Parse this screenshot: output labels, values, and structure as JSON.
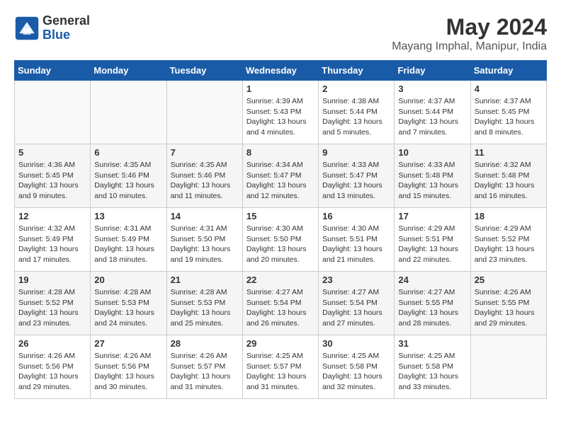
{
  "logo": {
    "general": "General",
    "blue": "Blue"
  },
  "title": "May 2024",
  "subtitle": "Mayang Imphal, Manipur, India",
  "weekdays": [
    "Sunday",
    "Monday",
    "Tuesday",
    "Wednesday",
    "Thursday",
    "Friday",
    "Saturday"
  ],
  "weeks": [
    [
      {
        "day": "",
        "info": ""
      },
      {
        "day": "",
        "info": ""
      },
      {
        "day": "",
        "info": ""
      },
      {
        "day": "1",
        "info": "Sunrise: 4:39 AM\nSunset: 5:43 PM\nDaylight: 13 hours\nand 4 minutes."
      },
      {
        "day": "2",
        "info": "Sunrise: 4:38 AM\nSunset: 5:44 PM\nDaylight: 13 hours\nand 5 minutes."
      },
      {
        "day": "3",
        "info": "Sunrise: 4:37 AM\nSunset: 5:44 PM\nDaylight: 13 hours\nand 7 minutes."
      },
      {
        "day": "4",
        "info": "Sunrise: 4:37 AM\nSunset: 5:45 PM\nDaylight: 13 hours\nand 8 minutes."
      }
    ],
    [
      {
        "day": "5",
        "info": "Sunrise: 4:36 AM\nSunset: 5:45 PM\nDaylight: 13 hours\nand 9 minutes."
      },
      {
        "day": "6",
        "info": "Sunrise: 4:35 AM\nSunset: 5:46 PM\nDaylight: 13 hours\nand 10 minutes."
      },
      {
        "day": "7",
        "info": "Sunrise: 4:35 AM\nSunset: 5:46 PM\nDaylight: 13 hours\nand 11 minutes."
      },
      {
        "day": "8",
        "info": "Sunrise: 4:34 AM\nSunset: 5:47 PM\nDaylight: 13 hours\nand 12 minutes."
      },
      {
        "day": "9",
        "info": "Sunrise: 4:33 AM\nSunset: 5:47 PM\nDaylight: 13 hours\nand 13 minutes."
      },
      {
        "day": "10",
        "info": "Sunrise: 4:33 AM\nSunset: 5:48 PM\nDaylight: 13 hours\nand 15 minutes."
      },
      {
        "day": "11",
        "info": "Sunrise: 4:32 AM\nSunset: 5:48 PM\nDaylight: 13 hours\nand 16 minutes."
      }
    ],
    [
      {
        "day": "12",
        "info": "Sunrise: 4:32 AM\nSunset: 5:49 PM\nDaylight: 13 hours\nand 17 minutes."
      },
      {
        "day": "13",
        "info": "Sunrise: 4:31 AM\nSunset: 5:49 PM\nDaylight: 13 hours\nand 18 minutes."
      },
      {
        "day": "14",
        "info": "Sunrise: 4:31 AM\nSunset: 5:50 PM\nDaylight: 13 hours\nand 19 minutes."
      },
      {
        "day": "15",
        "info": "Sunrise: 4:30 AM\nSunset: 5:50 PM\nDaylight: 13 hours\nand 20 minutes."
      },
      {
        "day": "16",
        "info": "Sunrise: 4:30 AM\nSunset: 5:51 PM\nDaylight: 13 hours\nand 21 minutes."
      },
      {
        "day": "17",
        "info": "Sunrise: 4:29 AM\nSunset: 5:51 PM\nDaylight: 13 hours\nand 22 minutes."
      },
      {
        "day": "18",
        "info": "Sunrise: 4:29 AM\nSunset: 5:52 PM\nDaylight: 13 hours\nand 23 minutes."
      }
    ],
    [
      {
        "day": "19",
        "info": "Sunrise: 4:28 AM\nSunset: 5:52 PM\nDaylight: 13 hours\nand 23 minutes."
      },
      {
        "day": "20",
        "info": "Sunrise: 4:28 AM\nSunset: 5:53 PM\nDaylight: 13 hours\nand 24 minutes."
      },
      {
        "day": "21",
        "info": "Sunrise: 4:28 AM\nSunset: 5:53 PM\nDaylight: 13 hours\nand 25 minutes."
      },
      {
        "day": "22",
        "info": "Sunrise: 4:27 AM\nSunset: 5:54 PM\nDaylight: 13 hours\nand 26 minutes."
      },
      {
        "day": "23",
        "info": "Sunrise: 4:27 AM\nSunset: 5:54 PM\nDaylight: 13 hours\nand 27 minutes."
      },
      {
        "day": "24",
        "info": "Sunrise: 4:27 AM\nSunset: 5:55 PM\nDaylight: 13 hours\nand 28 minutes."
      },
      {
        "day": "25",
        "info": "Sunrise: 4:26 AM\nSunset: 5:55 PM\nDaylight: 13 hours\nand 29 minutes."
      }
    ],
    [
      {
        "day": "26",
        "info": "Sunrise: 4:26 AM\nSunset: 5:56 PM\nDaylight: 13 hours\nand 29 minutes."
      },
      {
        "day": "27",
        "info": "Sunrise: 4:26 AM\nSunset: 5:56 PM\nDaylight: 13 hours\nand 30 minutes."
      },
      {
        "day": "28",
        "info": "Sunrise: 4:26 AM\nSunset: 5:57 PM\nDaylight: 13 hours\nand 31 minutes."
      },
      {
        "day": "29",
        "info": "Sunrise: 4:25 AM\nSunset: 5:57 PM\nDaylight: 13 hours\nand 31 minutes."
      },
      {
        "day": "30",
        "info": "Sunrise: 4:25 AM\nSunset: 5:58 PM\nDaylight: 13 hours\nand 32 minutes."
      },
      {
        "day": "31",
        "info": "Sunrise: 4:25 AM\nSunset: 5:58 PM\nDaylight: 13 hours\nand 33 minutes."
      },
      {
        "day": "",
        "info": ""
      }
    ]
  ]
}
